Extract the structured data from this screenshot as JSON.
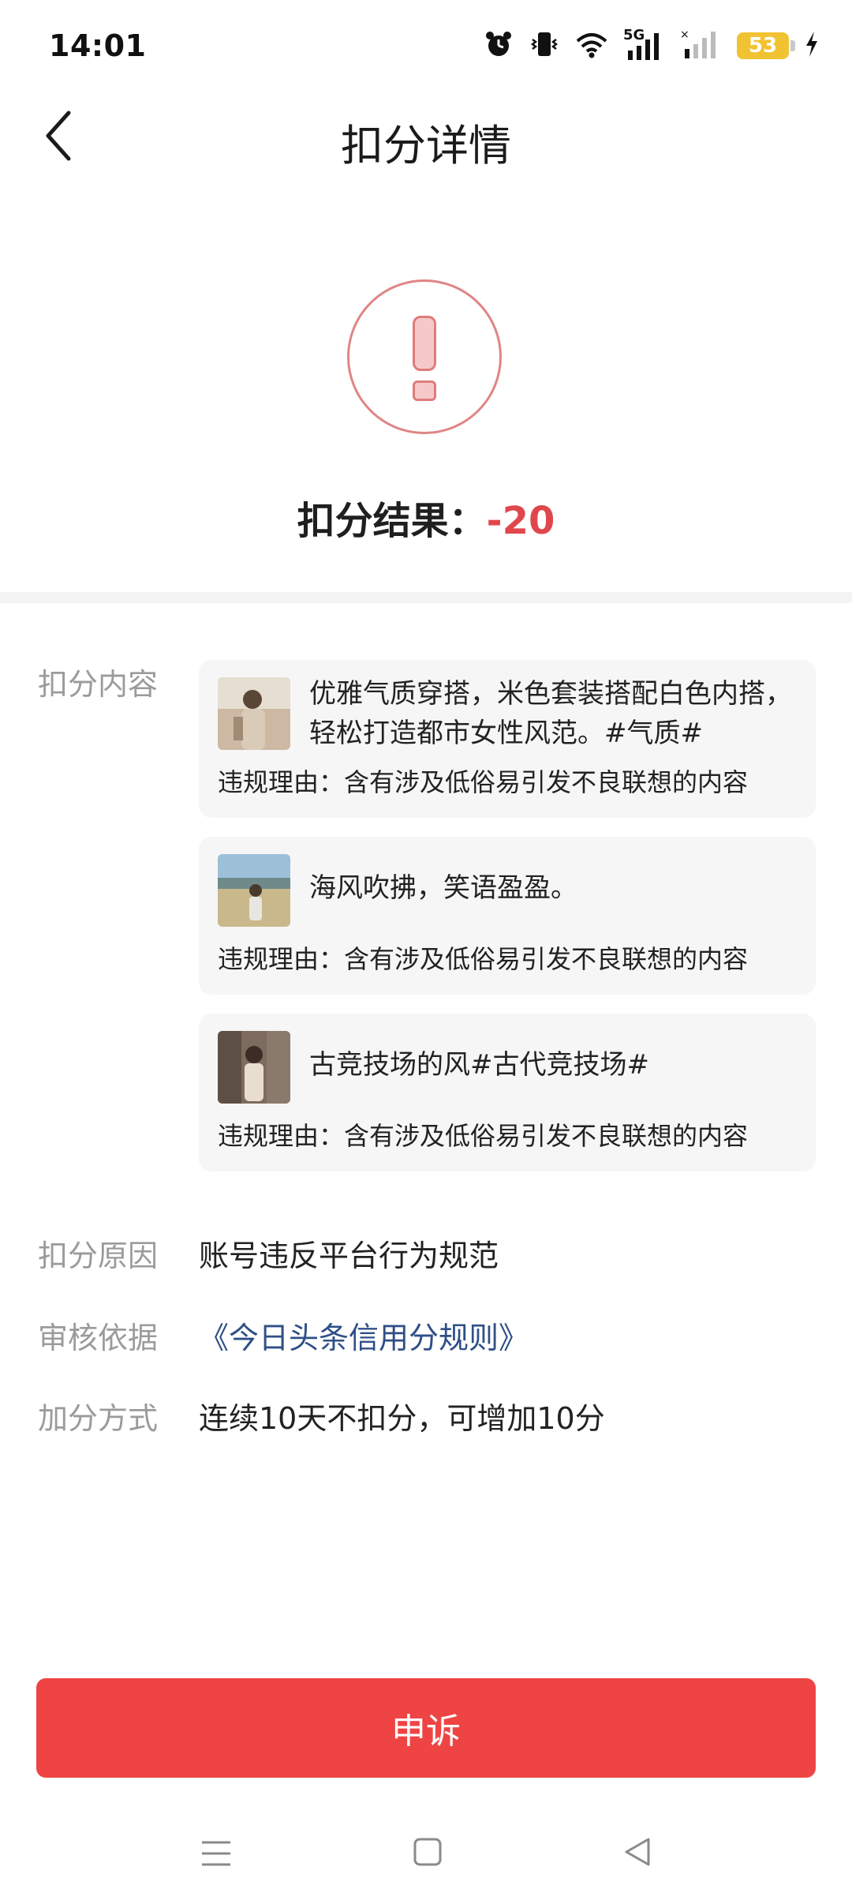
{
  "status_bar": {
    "time": "14:01",
    "signal_label": "5G",
    "battery_level": "53",
    "icons": [
      "alarm-icon",
      "vibrate-icon",
      "wifi-icon",
      "cellular-5g-icon",
      "cellular-icon",
      "battery-icon",
      "charging-icon"
    ]
  },
  "header": {
    "title": "扣分详情",
    "back_icon": "chevron-left-icon"
  },
  "result": {
    "label": "扣分结果：",
    "score": "-20",
    "icon": "exclamation-icon"
  },
  "content_section": {
    "label": "扣分内容",
    "items": [
      {
        "text": "优雅气质穿搭，米色套装搭配白色内搭，轻松打造都市女性风范。#气质#",
        "reason": "违规理由：含有涉及低俗易引发不良联想的内容",
        "thumb_icon": "photo-thumbnail"
      },
      {
        "text": "海风吹拂，笑语盈盈。",
        "reason": "违规理由：含有涉及低俗易引发不良联想的内容",
        "thumb_icon": "photo-thumbnail"
      },
      {
        "text": "古竞技场的风#古代竞技场#",
        "reason": "违规理由：含有涉及低俗易引发不良联想的内容",
        "thumb_icon": "photo-thumbnail"
      }
    ]
  },
  "reason_section": {
    "label": "扣分原因",
    "value": "账号违反平台行为规范"
  },
  "basis_section": {
    "label": "审核依据",
    "value": "《今日头条信用分规则》"
  },
  "bonus_section": {
    "label": "加分方式",
    "value": "连续10天不扣分，可增加10分"
  },
  "appeal_button": {
    "label": "申诉"
  },
  "nav_bar": {
    "icons": [
      "menu-icon",
      "home-square-icon",
      "back-triangle-icon"
    ]
  },
  "colors": {
    "accent_red": "#ef4444",
    "score_red": "#e0474c",
    "link_blue": "#2f4f86",
    "label_gray": "#9b9b9b",
    "card_bg": "#f6f6f6"
  }
}
